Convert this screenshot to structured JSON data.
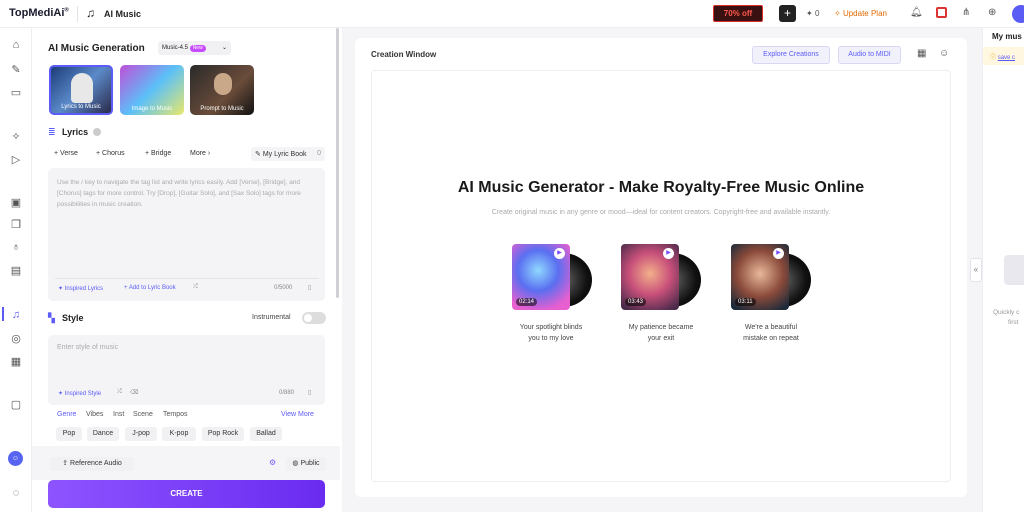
{
  "topbar": {
    "logo": "TopMediAi",
    "logo_mark": "®",
    "app_title": "AI Music",
    "promo": "70% off",
    "credits": "0",
    "update_plan": "Update Plan"
  },
  "left": {
    "title": "AI Music Generation",
    "version": "Music-4.5",
    "version_badge": "New",
    "modes": [
      {
        "label": "Lyrics to Music"
      },
      {
        "label": "Image to Music"
      },
      {
        "label": "Prompt to Music"
      }
    ],
    "lyrics_heading": "Lyrics",
    "chips": [
      "+ Verse",
      "+ Chorus",
      "+ Bridge",
      "More"
    ],
    "lyric_book": "My Lyric Book",
    "lyric_book_count": "0",
    "lyrics_placeholder": "Use the / key to navigate the tag list and write lyrics easily. Add [Verse], [Bridge], and [Chorus] tags for more control. Try [Drop], [Guitar Solo], and [Sax Solo] tags for more possibilities in music creation.",
    "inspired_lyrics": "Inspired Lyrics",
    "add_lyric_book": "Add to Lyric Book",
    "lyrics_count": "0/5000",
    "style_heading": "Style",
    "instrumental": "Instrumental",
    "style_placeholder": "Enter style of music",
    "inspired_style": "Inspired Style",
    "style_count": "0/880",
    "genre_tabs": [
      "Genre",
      "Vibes",
      "Inst",
      "Scene",
      "Tempos"
    ],
    "view_more": "View More",
    "genres": [
      "Pop",
      "Dance",
      "J-pop",
      "K-pop",
      "Pop Rock",
      "Ballad"
    ],
    "reference_audio": "Reference Audio",
    "public": "Public",
    "create": "CREATE"
  },
  "main": {
    "window_title": "Creation Window",
    "explore": "Explore Creations",
    "audio_midi": "Audio to MIDI",
    "hero": "AI Music Generator - Make Royalty-Free Music Online",
    "subtitle": "Create original music in any genre or mood—ideal for content creators. Copyright-free and available instantly.",
    "songs": [
      {
        "dur": "02:14",
        "line1": "Your spotlight blinds",
        "line2": "you to my love"
      },
      {
        "dur": "03:43",
        "line1": "My patience became",
        "line2": "your exit"
      },
      {
        "dur": "03:11",
        "line1": "We're a beautiful",
        "line2": "mistake on repeat"
      }
    ]
  },
  "right": {
    "title": "My mus",
    "save": "save c",
    "hint1": "Quickly c",
    "hint2": "first"
  }
}
